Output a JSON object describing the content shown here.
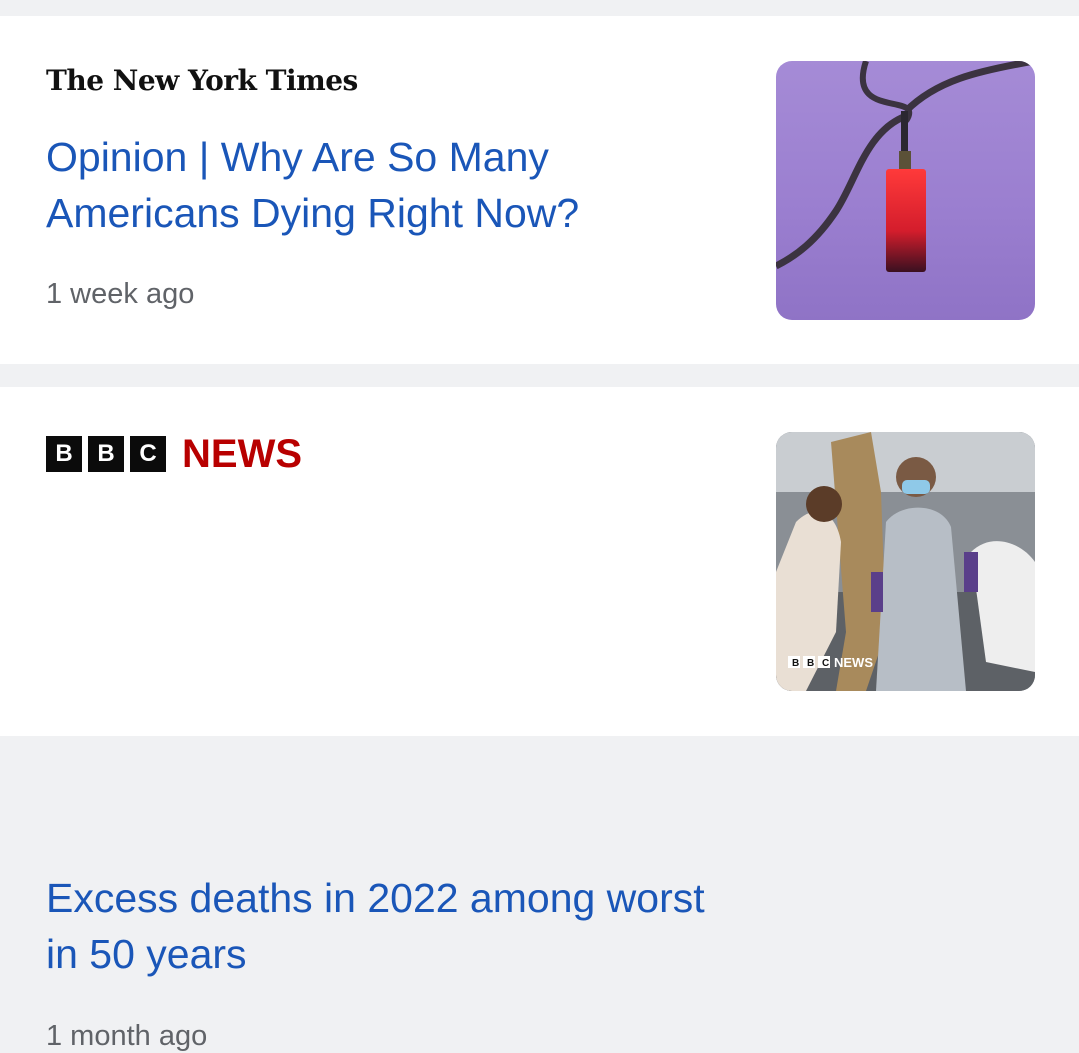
{
  "articles": [
    {
      "source": "The New York Times",
      "headline": "Opinion | Why Are So Many Americans Dying Right Now?",
      "timestamp": "1 week ago",
      "thumbnail_icon": "blood-bag-tube-image"
    },
    {
      "source_blocks": [
        "B",
        "B",
        "C"
      ],
      "source_news": "NEWS",
      "headline": "Excess deaths in 2022 among worst in 50 years",
      "timestamp": "1 month ago",
      "thumbnail_icon": "hospital-staff-image",
      "thumbnail_watermark": "BBC NEWS"
    }
  ],
  "colors": {
    "headline": "#1a56b8",
    "timestamp": "#606368",
    "bbc_red": "#b80000",
    "page_background": "#f0f1f3"
  }
}
